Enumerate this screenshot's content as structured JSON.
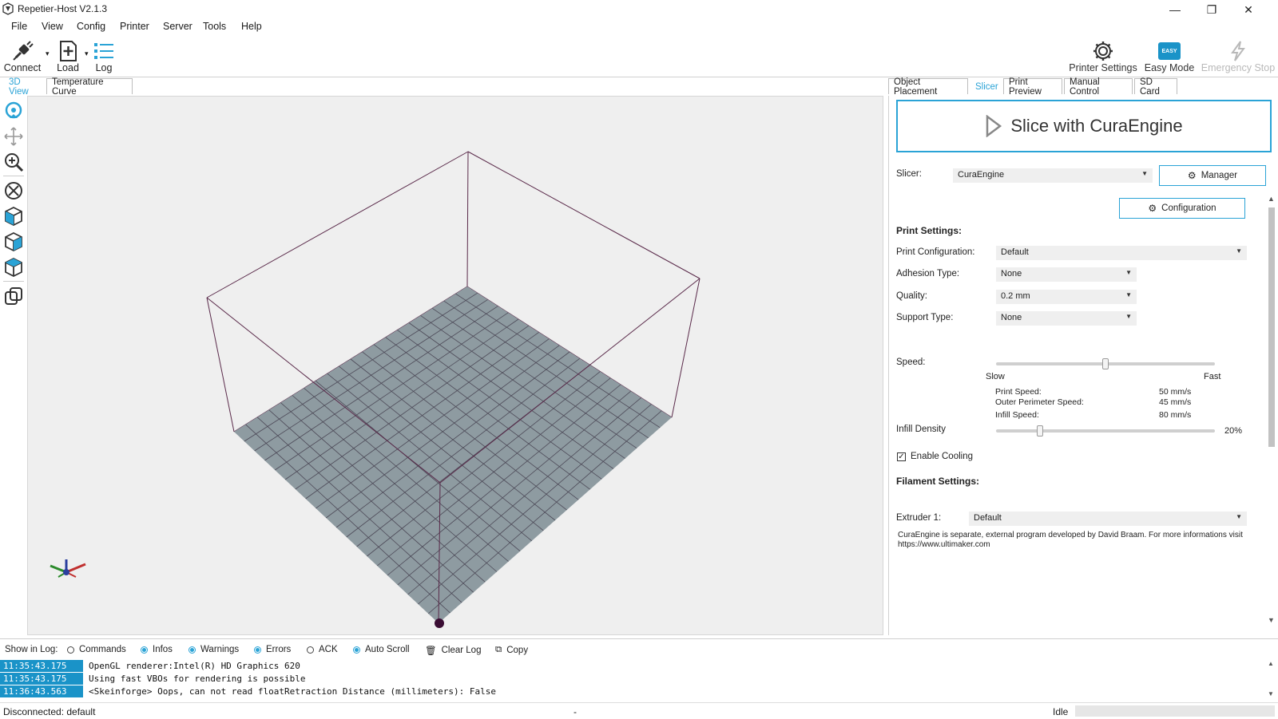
{
  "window": {
    "title": "Repetier-Host V2.1.3",
    "minimize": "—",
    "maximize": "❐",
    "close": "✕"
  },
  "menu": [
    "File",
    "View",
    "Config",
    "Printer",
    "Server",
    "Tools",
    "Help"
  ],
  "toolbar": {
    "connect": "Connect",
    "load": "Load",
    "log": "Log",
    "printer_settings": "Printer Settings",
    "easy_mode": "Easy Mode",
    "easy_badge": "EASY",
    "emergency_stop": "Emergency Stop"
  },
  "left_tabs": [
    "3D View",
    "Temperature Curve"
  ],
  "right_tabs": [
    "Object Placement",
    "Slicer",
    "Print Preview",
    "Manual Control",
    "SD Card"
  ],
  "slicer": {
    "slice_button": "Slice with CuraEngine",
    "slicer_label": "Slicer:",
    "slicer_value": "CuraEngine",
    "manager": "Manager",
    "configuration": "Configuration",
    "print_settings": "Print Settings:",
    "print_config_label": "Print Configuration:",
    "print_config_value": "Default",
    "adhesion_label": "Adhesion Type:",
    "adhesion_value": "None",
    "quality_label": "Quality:",
    "quality_value": "0.2 mm",
    "support_label": "Support Type:",
    "support_value": "None",
    "speed_label": "Speed:",
    "speed_slow": "Slow",
    "speed_fast": "Fast",
    "speed_level": 0.5,
    "print_speed_label": "Print Speed:",
    "print_speed_value": "50 mm/s",
    "outer_speed_label": "Outer Perimeter Speed:",
    "outer_speed_value": "45 mm/s",
    "infill_speed_label": "Infill Speed:",
    "infill_speed_value": "80 mm/s",
    "infill_label": "Infill Density",
    "infill_value": "20%",
    "cooling_label": "Enable Cooling",
    "cooling_checked": true,
    "filament_settings": "Filament Settings:",
    "extruder_label": "Extruder 1:",
    "extruder_value": "Default",
    "note": "CuraEngine is separate, external program developed by David Braam. For more informations visit https://www.ultimaker.com"
  },
  "log": {
    "show_label": "Show in Log:",
    "options": [
      {
        "label": "Commands",
        "on": false
      },
      {
        "label": "Infos",
        "on": true
      },
      {
        "label": "Warnings",
        "on": true
      },
      {
        "label": "Errors",
        "on": true
      },
      {
        "label": "ACK",
        "on": false
      },
      {
        "label": "Auto Scroll",
        "on": true
      }
    ],
    "clear": "Clear Log",
    "copy": "Copy",
    "lines": [
      {
        "time": "11:35:43.175",
        "msg": "OpenGL renderer:Intel(R) HD Graphics 620"
      },
      {
        "time": "11:35:43.175",
        "msg": "Using fast VBOs for rendering is possible"
      },
      {
        "time": "11:36:43.563",
        "msg": "<Skeinforge> Oops, can not read floatRetraction Distance (millimeters): False"
      }
    ]
  },
  "status": {
    "left": "Disconnected: default",
    "middle": "-",
    "right": "Idle"
  },
  "colors": {
    "accent": "#2aa3d6",
    "bed": "#8e9ba1",
    "frame": "#5a2a4a"
  },
  "icons": [
    "app-icon",
    "connect-icon",
    "load-icon",
    "log-icon",
    "gear-icon",
    "easy-icon",
    "lightning-icon",
    "rotate-icon",
    "move-icon",
    "zoom-icon",
    "fit-icon",
    "view-front-icon",
    "view-side-icon",
    "view-top-icon",
    "parallel-icon",
    "axes-icon",
    "play-icon",
    "trash-icon",
    "copy-icon"
  ]
}
